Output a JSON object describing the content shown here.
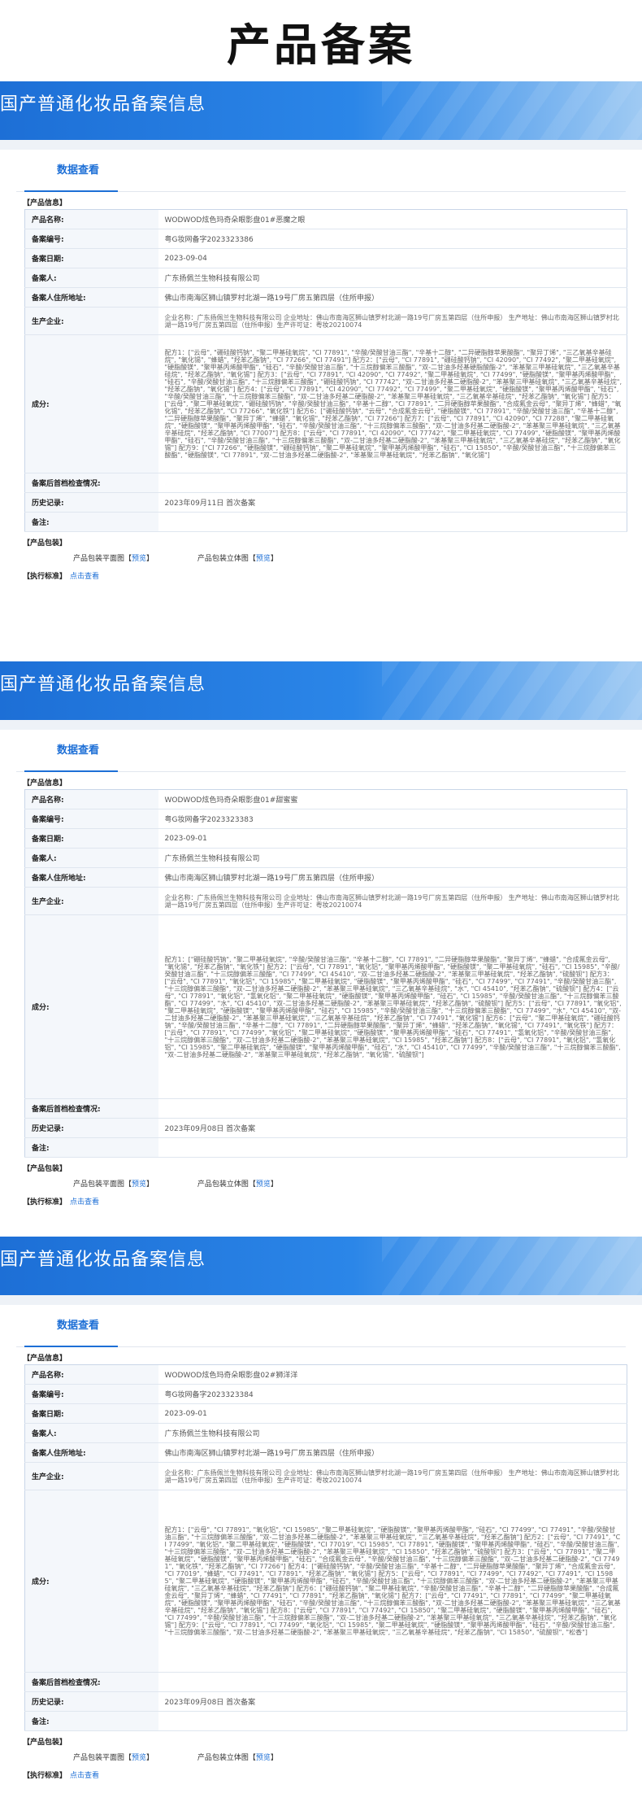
{
  "page_title": "产品备案",
  "labels": {
    "banner": "国产普通化妆品备案信息",
    "tab": "数据查看",
    "product_info": "【产品信息】",
    "product_name": "产品名称:",
    "record_no": "备案编号:",
    "record_date": "备案日期:",
    "registrant": "备案人:",
    "registrant_address": "备案人住所地址:",
    "manufacturer": "生产企业:",
    "ingredients": "成分:",
    "post_check": "备案后首档检查情况:",
    "history": "历史记录:",
    "remark": "备注:",
    "packaging": "【产品包装】",
    "pkg_flat": "产品包装平面图",
    "pkg_3d": "产品包装立体图",
    "preview": "预览",
    "lbracket": "【",
    "rbracket": "】",
    "exec_std": "【执行标准】",
    "click_view": "点击查看"
  },
  "records": [
    {
      "product_name": "WODWOD炫色玛奇朵眼影盘01#恶魔之眼",
      "record_no": "粤G妆网备字2023323386",
      "record_date": "2023-09-04",
      "registrant": "广东扬佩兰生物科技有限公司",
      "registrant_address": "佛山市南海区狮山镇罗村北湖一路19号厂房五第四层（住所申报）",
      "manufacturer": "企业名称：广东扬佩兰生物科技有限公司 企业地址：佛山市南海区狮山镇罗村北湖一路19号厂房五第四层（住所申报） 生产地址：佛山市南海区狮山镇罗村北湖一路19号厂房五第四层（住所申报）生产许可证：粤妆20210074",
      "ingredients": "配方1：[\"云母\", \"硼硅酸钙钠\", \"聚二甲基硅氧烷\", \"CI 77891\", \"辛酸/癸酸甘油三酯\", \"辛基十二醇\", \"二异硬脂醇苹果酸酯\", \"聚异丁烯\", \"三乙氧基辛基硅烷\", \"氧化锡\", \"蜂蜡\", \"羟苯乙酯钠\", \"CI 77266\", \"CI 77491\"] 配方2：[\"云母\", \"CI 77891\", \"硼硅酸钙钠\", \"CI 42090\", \"CI 77492\", \"聚二甲基硅氧烷\", \"硬脂酸镁\", \"聚甲基丙烯酸甲酯\", \"硅石\", \"辛酸/癸酸甘油三酯\", \"十三烷醇偏苯三酸酯\", \"双-二甘油多羟基硬脂酸酯-2\", \"苯基聚三甲基硅氧烷\", \"三乙氧基辛基硅烷\", \"羟苯乙酯钠\", \"氧化锡\"] 配方3：[\"云母\", \"CI 77891\", \"CI 42090\", \"CI 77492\", \"聚二甲基硅氧烷\", \"CI 77499\", \"硬脂酸镁\", \"聚甲基丙烯酸甲酯\", \"硅石\", \"辛酸/癸酸甘油三酯\", \"十三烷醇偏苯三酸酯\", \"硼硅酸钙钠\", \"CI 77742\", \"双-二甘油多羟基二硬脂酸-2\", \"苯基聚三甲基硅氧烷\", \"三乙氧基辛基硅烷\", \"羟苯乙酯钠\", \"氧化锡\"] 配方4：[\"云母\", \"CI 77891\", \"CI 42090\", \"CI 77492\", \"CI 77499\", \"聚二甲基硅氧烷\", \"硬脂酸镁\", \"聚甲基丙烯酸甲酯\", \"硅石\", \"辛酸/癸酸甘油三酯\", \"十三烷醇偏苯三酸酯\", \"双-二甘油多羟基二硬脂酸-2\", \"苯基聚三甲基硅氧烷\", \"三乙氧基辛基硅烷\", \"羟苯乙酯钠\", \"氧化锡\"] 配方5：[\"云母\", \"聚二甲基硅氧烷\", \"硼硅酸钙钠\", \"辛酸/癸酸甘油三酯\", \"辛基十二醇\", \"CI 77891\", \"二异硬脂醇苹果酸酯\", \"合成氟金云母\", \"聚异丁烯\", \"蜂蜡\", \"氧化锡\", \"羟苯乙酯钠\", \"CI 77266\", \"氧化铁\"] 配方6：[\"硼硅酸钙钠\", \"云母\", \"合成氟金云母\", \"硬脂酸镁\", \"CI 77891\", \"辛酸/癸酸甘油三酯\", \"辛基十二醇\", \"二异硬脂醇苹果酸酯\", \"聚异丁烯\", \"蜂蜡\", \"氧化锡\", \"羟苯乙酯钠\", \"CI 77266\"] 配方7：[\"云母\", \"CI 77891\", \"CI 42090\", \"CI 77288\", \"聚二甲基硅氧烷\", \"硬脂酸镁\", \"聚甲基丙烯酸甲酯\", \"硅石\", \"辛酸/癸酸甘油三酯\", \"十三烷醇偏苯三酸酯\", \"双-二甘油多羟基二硬脂酸-2\", \"苯基聚三甲基硅氧烷\", \"三乙氧基辛基硅烷\", \"羟苯乙酯钠\", \"CI 77007\"] 配方8：[\"云母\", \"CI 77891\", \"CI 42090\", \"CI 77742\", \"聚二甲基硅氧烷\", \"CI 77499\", \"硬脂酸镁\", \"聚甲基丙烯酸甲酯\", \"硅石\", \"辛酸/癸酸甘油三酯\", \"十三烷醇偏苯三酸酯\", \"双-二甘油多羟基二硬脂酸-2\", \"苯基聚三甲基硅氧烷\", \"三乙氧基辛基硅烷\", \"羟苯乙酯钠\", \"氧化锡\"] 配方9：[\"CI 77266\", \"硬脂酸镁\", \"硼硅酸钙钠\", \"聚二甲基硅氧烷\", \"聚甲基丙烯酸甲酯\", \"硅石\", \"CI 15850\", \"辛酸/癸酸甘油三酯\", \"十三烷醇偏苯三酸酯\", \"硬脂酸镁\", \"CI 77891\", \"双-二甘油多羟基二硬脂酸-2\", \"苯基聚三甲基硅氧烷\", \"羟苯乙酯钠\", \"氧化锡\"]",
      "post_check": "",
      "history": "2023年09月11日 首次备案",
      "remark": ""
    },
    {
      "product_name": "WODWOD炫色玛奇朵眼影盘01#甜蜜蜜",
      "record_no": "粤G妆网备字2023323383",
      "record_date": "2023-09-01",
      "registrant": "广东扬佩兰生物科技有限公司",
      "registrant_address": "佛山市南海区狮山镇罗村北湖一路19号厂房五第四层（住所申报）",
      "manufacturer": "企业名称：广东扬佩兰生物科技有限公司 企业地址：佛山市南海区狮山镇罗村北湖一路19号厂房五第四层（住所申报） 生产地址：佛山市南海区狮山镇罗村北湖一路19号厂房五第四层（住所申报）生产许可证：粤妆20210074",
      "ingredients": "配方1：[\"硼硅酸钙钠\", \"聚二甲基硅氧烷\", \"辛酸/癸酸甘油三酯\", \"辛基十二醇\", \"CI 77891\", \"二异硬脂醇苹果酸酯\", \"聚异丁烯\", \"蜂蜡\", \"合成氟金云母\", \"氧化锡\", \"羟苯乙酯钠\", \"氧化铁\"] 配方2：[\"云母\", \"CI 77891\", \"氧化铝\", \"聚甲基丙烯酸甲酯\", \"硬脂酸镁\", \"聚二甲基硅氧烷\", \"硅石\", \"CI 15985\", \"辛酸/癸酸甘油三酯\", \"十三烷醇偏苯三酸酯\", \"CI 77499\", \"CI 45410\", \"双-二甘油多羟基二硬脂酸-2\", \"苯基聚三甲基硅氧烷\", \"羟苯乙酯钠\", \"硫酸钡\"] 配方3：[\"云母\", \"CI 77891\", \"氧化铝\", \"CI 15985\", \"聚二甲基硅氧烷\", \"硬脂酸镁\", \"聚甲基丙烯酸甲酯\", \"硅石\", \"CI 77499\", \"CI 77491\", \"辛酸/癸酸甘油三酯\", \"十三烷醇偏苯三酸酯\", \"双-二甘油多羟基二硬脂酸-2\", \"苯基聚三甲基硅氧烷\", \"三乙氧基辛基硅烷\", \"水\", \"CI 45410\", \"羟苯乙酯钠\", \"硫酸钡\"] 配方4：[\"云母\", \"CI 77891\", \"氧化铝\", \"氢氧化铝\", \"聚二甲基硅氧烷\", \"硬脂酸镁\", \"聚甲基丙烯酸甲酯\", \"硅石\", \"CI 15985\", \"辛酸/癸酸甘油三酯\", \"十三烷醇偏苯三酸酯\", \"CI 77499\", \"水\", \"CI 45410\", \"双-二甘油多羟基二硬脂酸-2\", \"苯基聚三甲基硅氧烷\", \"羟苯乙酯钠\", \"硫酸钡\"] 配方5：[\"云母\", \"CI 77891\", \"氧化铝\", \"聚二甲基硅氧烷\", \"硬脂酸镁\", \"聚甲基丙烯酸甲酯\", \"硅石\", \"CI 15985\", \"辛酸/癸酸甘油三酯\", \"十三烷醇偏苯三酸酯\", \"CI 77499\", \"水\", \"CI 45410\", \"双-二甘油多羟基二硬脂酸-2\", \"苯基聚三甲基硅氧烷\", \"三乙氧基辛基硅烷\", \"羟苯乙酯钠\", \"CI 77491\", \"氧化锡\"] 配方6：[\"云母\", \"聚二甲基硅氧烷\", \"硼硅酸钙钠\", \"辛酸/癸酸甘油三酯\", \"辛基十二醇\", \"CI 77891\", \"二异硬脂醇苹果酸酯\", \"聚异丁烯\", \"蜂蜡\", \"羟苯乙酯钠\", \"氧化锡\", \"CI 77491\", \"氧化铁\"] 配方7：[\"云母\", \"CI 77891\", \"CI 77499\", \"氧化铝\", \"聚二甲基硅氧烷\", \"硬脂酸镁\", \"聚甲基丙烯酸甲酯\", \"硅石\", \"CI 77491\", \"氢氧化铝\", \"辛酸/癸酸甘油三酯\", \"十三烷醇偏苯三酸酯\", \"双-二甘油多羟基二硬脂酸-2\", \"苯基聚三甲基硅氧烷\", \"CI 15985\", \"羟苯乙酯钠\"] 配方8：[\"云母\", \"CI 77891\", \"氧化铝\", \"氢氧化铝\", \"CI 15985\", \"聚二甲基硅氧烷\", \"硬脂酸镁\", \"聚甲基丙烯酸甲酯\", \"硅石\", \"水\", \"CI 45410\", \"CI 77499\", \"辛酸/癸酸甘油三酯\", \"十三烷醇偏苯三酸酯\", \"双-二甘油多羟基二硬脂酸-2\", \"苯基聚三甲基硅氧烷\", \"羟苯乙酯钠\", \"氧化锡\", \"硫酸钡\"]",
      "post_check": "",
      "history": "2023年09月08日 首次备案",
      "remark": ""
    },
    {
      "product_name": "WODWOD炫色玛奇朵眼影盘02#狮洋洋",
      "record_no": "粤G妆网备字2023323384",
      "record_date": "2023-09-01",
      "registrant": "广东扬佩兰生物科技有限公司",
      "registrant_address": "佛山市南海区狮山镇罗村北湖一路19号厂房五第四层（住所申报）",
      "manufacturer": "企业名称：广东扬佩兰生物科技有限公司 企业地址：佛山市南海区狮山镇罗村北湖一路19号厂房五第四层（住所申报） 生产地址：佛山市南海区狮山镇罗村北湖一路19号厂房五第四层（住所申报）生产许可证：粤妆20210074",
      "ingredients": "配方1：[\"云母\", \"CI 77891\", \"氧化铝\", \"CI 15985\", \"聚二甲基硅氧烷\", \"硬脂酸镁\", \"聚甲基丙烯酸甲酯\", \"硅石\", \"CI 77499\", \"CI 77491\", \"辛酸/癸酸甘油三酯\", \"十三烷醇偏苯三酸酯\", \"双-二甘油多羟基二硬脂酸-2\", \"苯基聚三甲基硅氧烷\", \"三乙氧基辛基硅烷\", \"羟苯乙酯钠\"] 配方2：[\"云母\", \"CI 77491\", \"CI 77499\", \"氧化铝\", \"聚二甲基硅氧烷\", \"硬脂酸镁\", \"CI 77019\", \"CI 15985\", \"CI 77891\", \"硬脂酸镁\", \"聚甲基丙烯酸甲酯\", \"硅石\", \"辛酸/癸酸甘油三酯\", \"十三烷醇偏苯三酸酯\", \"双-二甘油多羟基二硬脂酸-2\", \"苯基聚三甲基硅氧烷\", \"CI 15850\", \"羟苯乙酯钠\", \"硫酸钡\"] 配方3：[\"云母\", \"CI 77891\", \"聚二甲基硅氧烷\", \"硬脂酸镁\", \"聚甲基丙烯酸甲酯\", \"硅石\", \"合成氟金云母\", \"辛酸/癸酸甘油三酯\", \"十三烷醇偏苯三酸酯\", \"双-二甘油多羟基二硬脂酸-2\", \"CI 77491\", \"氧化铁\", \"羟苯乙酯钠\", \"CI 77266\"] 配方4：[\"硼硅酸钙钠\", \"辛酸/癸酸甘油三酯\", \"辛基十二醇\", \"二异硬脂醇苹果酸酯\", \"聚异丁烯\", \"合成氟金云母\", \"CI 77019\", \"蜂蜡\", \"CI 77491\", \"CI 77891\", \"羟苯乙酯钠\", \"氧化锡\"] 配方5：[\"云母\", \"CI 77891\", \"CI 77499\", \"CI 77492\", \"CI 77491\", \"CI 15985\", \"聚二甲基硅氧烷\", \"硬脂酸镁\", \"聚甲基丙烯酸甲酯\", \"硅石\", \"辛酸/癸酸甘油三酯\", \"十三烷醇偏苯三酸酯\", \"双-二甘油多羟基二硬脂酸-2\", \"苯基聚三甲基硅氧烷\", \"三乙氧基辛基硅烷\", \"羟苯乙酯钠\"] 配方6：[\"硼硅酸钙钠\", \"聚二甲基硅氧烷\", \"辛酸/癸酸甘油三酯\", \"辛基十二醇\", \"二异硬脂醇苹果酸酯\", \"合成氟金云母\", \"聚异丁烯\", \"蜂蜡\", \"CI 77491\", \"CI 77891\", \"羟苯乙酯钠\", \"氧化锡\"] 配方7：[\"云母\", \"CI 77491\", \"CI 77891\", \"CI 77499\", \"聚二甲基硅氧烷\", \"硬脂酸镁\", \"聚甲基丙烯酸甲酯\", \"硅石\", \"辛酸/癸酸甘油三酯\", \"十三烷醇偏苯三酸酯\", \"双-二甘油多羟基二硬脂酸-2\", \"苯基聚三甲基硅氧烷\", \"三乙氧基辛基硅烷\", \"羟苯乙酯钠\", \"氧化锡\"] 配方8：[\"云母\", \"CI 77891\", \"CI 77492\", \"CI 15850\", \"聚二甲基硅氧烷\", \"硬脂酸镁\", \"聚甲基丙烯酸甲酯\", \"硅石\", \"CI 77499\", \"辛酸/癸酸甘油三酯\", \"十三烷醇偏苯三酸酯\", \"双-二甘油多羟基二硬脂酸-2\", \"苯基聚三甲基硅氧烷\", \"三乙氧基辛基硅烷\", \"羟苯乙酯钠\", \"氧化锡\"] 配方9：[\"云母\", \"CI 77891\", \"CI 77499\", \"氧化铝\", \"CI 15985\", \"聚二甲基硅氧烷\", \"硬脂酸镁\", \"聚甲基丙烯酸甲酯\", \"硅石\", \"辛酸/癸酸甘油三酯\", \"十三烷醇偏苯三酸酯\", \"双-二甘油多羟基二硬脂酸-2\", \"苯基聚三甲基硅氧烷\", \"三乙氧基辛基硅烷\", \"羟苯乙酯钠\", \"CI 15850\", \"硫酸钡\", \"松香\"]",
      "post_check": "",
      "history": "2023年09月08日 首次备案",
      "remark": ""
    }
  ]
}
